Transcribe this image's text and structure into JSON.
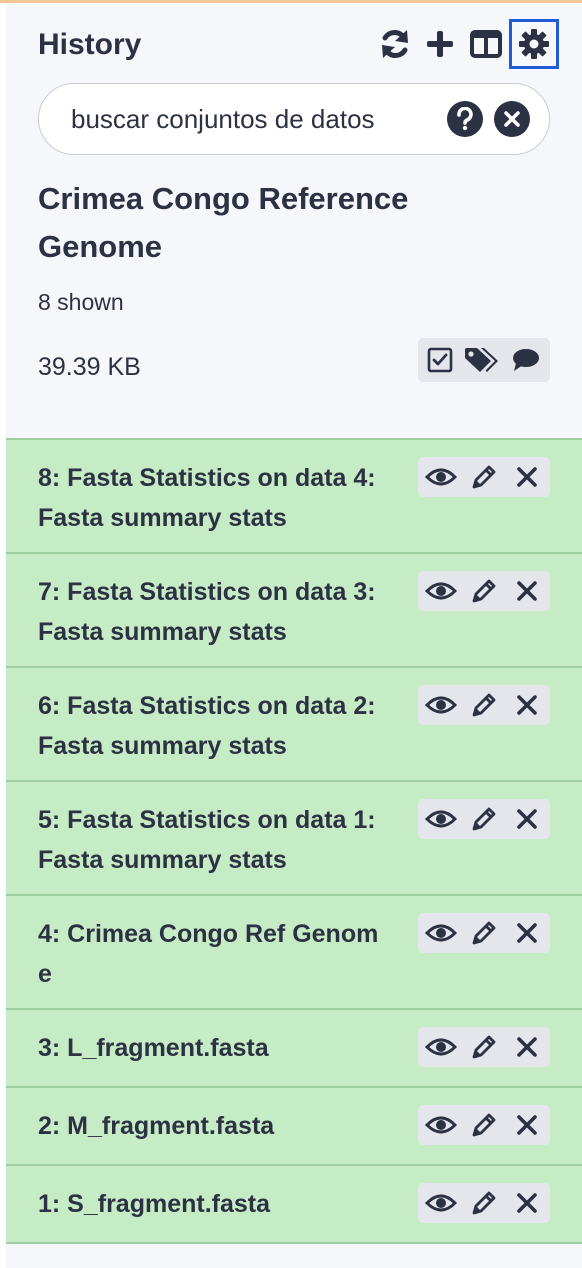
{
  "panel": {
    "title": "History",
    "icons": [
      "refresh-icon",
      "plus-icon",
      "columns-icon",
      "gear-icon"
    ]
  },
  "search": {
    "placeholder": "buscar conjuntos de datos",
    "value": "",
    "icons": [
      "help-icon",
      "clear-icon"
    ]
  },
  "history": {
    "name": "Crimea Congo Reference Genome",
    "shown": "8 shown",
    "size": "39.39 KB",
    "action_icons": [
      "check-square-icon",
      "tags-icon",
      "comment-icon"
    ]
  },
  "datasets": [
    {
      "title": "8: Fasta Statistics on data 4: Fasta summary stats"
    },
    {
      "title": "7: Fasta Statistics on data 3: Fasta summary stats"
    },
    {
      "title": "6: Fasta Statistics on data 2: Fasta summary stats"
    },
    {
      "title": "5: Fasta Statistics on data 1: Fasta summary stats"
    },
    {
      "title": "4: Crimea Congo Ref Genome"
    },
    {
      "title": "3: L_fragment.fasta"
    },
    {
      "title": "2: M_fragment.fasta"
    },
    {
      "title": "1: S_fragment.fasta"
    }
  ],
  "dataset_action_icons": [
    "eye-icon",
    "pencil-icon",
    "delete-icon"
  ],
  "colors": {
    "text": "#2c3143",
    "panel_bg": "#f6f7fa",
    "dataset_ok_bg": "#c6ecc5",
    "dataset_border": "#9fcea0",
    "focus_outline": "#1f5bd6",
    "top_accent": "#f6c795"
  }
}
